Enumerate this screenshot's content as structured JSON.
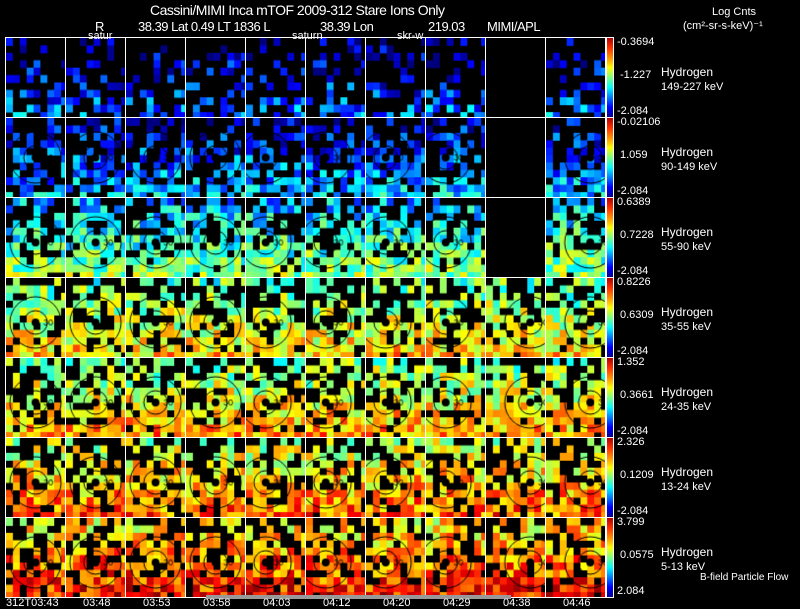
{
  "header": {
    "title": "Cassini/MIMI Inca mTOF  2009-312   Stare   Ions Only",
    "info": {
      "r_label": "R",
      "r_value": "38.39 Lat 0.49 LT 1836 L",
      "l_value": "38.39 Lon",
      "lon_value": "219.03",
      "source": "MIMI/APL"
    },
    "units_title": "Log Cnts",
    "units": "(cm²-sr-s-keV)⁻¹",
    "overlay_labels": [
      "satur",
      "saturn",
      "skr-w"
    ]
  },
  "chart_data": {
    "type": "heatmap",
    "title": "Cassini/MIMI Inca mTOF 2009-312 Stare Ions Only",
    "times": [
      "312T03:43",
      "03:48",
      "03:53",
      "03:58",
      "04:03",
      "04:12",
      "04:20",
      "04:29",
      "04:38",
      "04:46"
    ],
    "rows": [
      {
        "species": "Hydrogen",
        "energy": "149-227 keV",
        "max": "-0.3694",
        "mid": "-1.227",
        "min": "-2.084",
        "level": 0.15,
        "fill": 0.45
      },
      {
        "species": "Hydrogen",
        "energy": "90-149 keV",
        "max": "-0.02106",
        "mid": "1.059",
        "min": "-2.084",
        "level": 0.22,
        "fill": 0.7
      },
      {
        "species": "Hydrogen",
        "energy": "55-90 keV",
        "max": "0.6389",
        "mid": "0.7228",
        "min": "-2.084",
        "level": 0.42,
        "fill": 0.85
      },
      {
        "species": "Hydrogen",
        "energy": "35-55 keV",
        "max": "0.8226",
        "mid": "0.6309",
        "min": "-2.084",
        "level": 0.58,
        "fill": 0.85
      },
      {
        "species": "Hydrogen",
        "energy": "24-35 keV",
        "max": "1.352",
        "mid": "0.3661",
        "min": "-2.084",
        "level": 0.62,
        "fill": 0.85
      },
      {
        "species": "Hydrogen",
        "energy": "13-24 keV",
        "max": "2.326",
        "mid": "0.1209",
        "min": "-2.084",
        "level": 0.68,
        "fill": 0.85
      },
      {
        "species": "Hydrogen",
        "energy": "5-13 keV",
        "max": "3.799",
        "mid": "0.0575",
        "min": "2.084",
        "level": 0.76,
        "fill": 0.9
      }
    ],
    "empty_panels": [
      [
        0,
        8
      ],
      [
        1,
        8
      ],
      [
        2,
        8
      ]
    ],
    "contour_labels": [
      "30",
      "60",
      "90",
      "120",
      "150",
      "180"
    ],
    "colormap": "jet"
  },
  "footer": {
    "legend": "B-field Particle Flow"
  }
}
